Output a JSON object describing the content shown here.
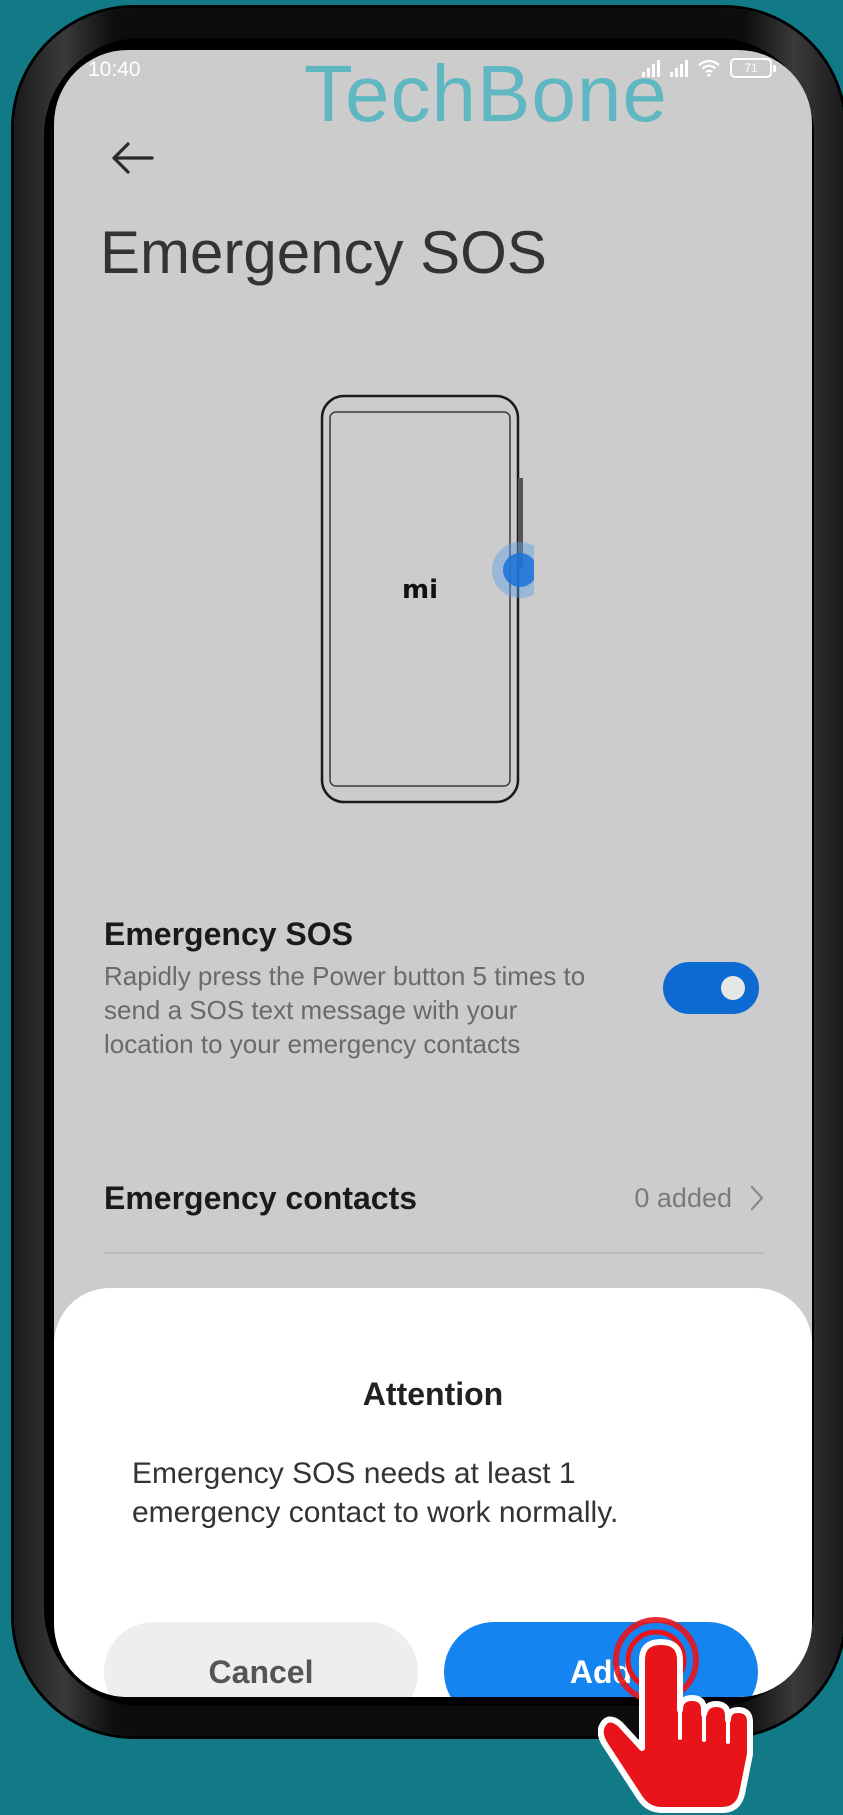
{
  "status_bar": {
    "time": "10:40",
    "battery": "71"
  },
  "watermark": "TechBone",
  "header": {
    "title": "Emergency SOS"
  },
  "illustration": {
    "logo": "mi"
  },
  "sos_setting": {
    "title": "Emergency SOS",
    "description": "Rapidly press the Power button 5 times to send a SOS text message with your location to your emergency contacts",
    "enabled": true
  },
  "contacts_setting": {
    "title": "Emergency contacts",
    "value": "0 added"
  },
  "dialog": {
    "title": "Attention",
    "message": "Emergency SOS needs at least 1 emergency contact to work normally.",
    "cancel_label": "Cancel",
    "add_label": "Add"
  },
  "colors": {
    "background": "#127a87",
    "accent": "#1485f0",
    "toggle": "#0d6ad3",
    "pointer": "#e8141a"
  }
}
